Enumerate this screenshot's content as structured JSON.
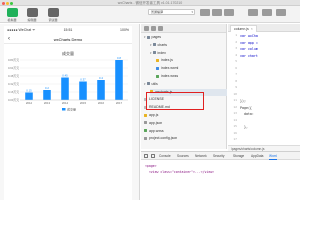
{
  "window": {
    "title": "wxCharts - 微信开发者工具 v1.01.170210"
  },
  "toolbar": {
    "items": [
      {
        "label": "模拟器",
        "icon": "phone-icon"
      },
      {
        "label": "编辑器",
        "icon": "code-icon"
      },
      {
        "label": "调试器",
        "icon": "debug-icon"
      }
    ],
    "compile_mode": "普通编译",
    "right_items": [
      "编译",
      "预览",
      "远程调试",
      "清缓存",
      "上传",
      "后台"
    ]
  },
  "simulator": {
    "status_left": "●●●●● WeChat ᯤ",
    "status_time": "15:51",
    "status_right": "100%",
    "nav_title": "wxCharts Demo",
    "back_glyph": "‹"
  },
  "chart_data": {
    "type": "bar",
    "title": "成交量",
    "categories": [
      "2012",
      "2013",
      "2014",
      "2015",
      "2016",
      "2017"
    ],
    "series": [
      {
        "name": "成交量",
        "values": [
          0.15,
          0.2,
          0.45,
          0.37,
          0.4,
          0.8
        ]
      }
    ],
    "ylim": [
      0,
      0.8
    ],
    "yticks": [
      "0.00",
      "0.16",
      "0.32",
      "0.48",
      "0.64",
      "0.80"
    ],
    "ytick_suffix": "万元",
    "data_labels": [
      "0.15",
      "0.2",
      "0.45",
      "0.37",
      "0.4",
      "0.8"
    ],
    "color": "#1890ff",
    "grid": true,
    "legend": "bottom"
  },
  "file_tree": {
    "items": [
      {
        "label": "pages",
        "type": "folder",
        "depth": 0
      },
      {
        "label": "charts",
        "type": "folder",
        "depth": 1
      },
      {
        "label": "index",
        "type": "folder",
        "depth": 1
      },
      {
        "label": "index.js",
        "type": "js",
        "depth": 2
      },
      {
        "label": "index.wxml",
        "type": "wxml",
        "depth": 2
      },
      {
        "label": "index.wxss",
        "type": "wxss",
        "depth": 2
      },
      {
        "label": "utils",
        "type": "folder",
        "depth": 0
      },
      {
        "label": "wxcharts.js",
        "type": "js",
        "depth": 1
      },
      {
        "label": "LICENSE",
        "type": "file",
        "depth": 0
      },
      {
        "label": "README.md",
        "type": "file",
        "depth": 0
      },
      {
        "label": "app.js",
        "type": "js",
        "depth": 0
      },
      {
        "label": "app.json",
        "type": "json",
        "depth": 0
      },
      {
        "label": "app.wxss",
        "type": "wxss",
        "depth": 0
      },
      {
        "label": "project.config.json",
        "type": "json",
        "depth": 0
      }
    ]
  },
  "editor": {
    "tab": "column.js",
    "lines": [
      "var wxCha",
      "var app =",
      "var colum",
      "var chart",
      "",
      "",
      "",
      "",
      "",
      "",
      "});",
      "Page({",
      "  data:",
      "",
      "  },",
      "",
      "",
      "  // b",
      "  //"
    ],
    "footer": "/pages/charts/column.js"
  },
  "devtools": {
    "tabs": [
      "Console",
      "Sources",
      "Network",
      "Security",
      "Storage",
      "AppData",
      "Wxml"
    ],
    "active_tab": "Wxml",
    "lines": [
      "<page>",
      "  <view class=\"container\">...</view>"
    ]
  }
}
